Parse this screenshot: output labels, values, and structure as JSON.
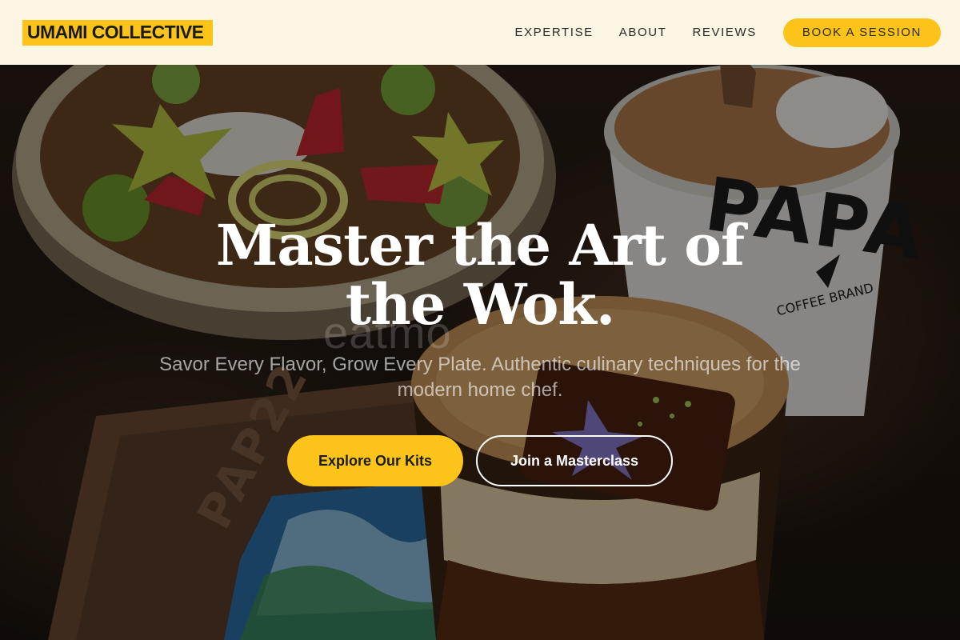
{
  "header": {
    "logo": "UMAMI COLLECTIVE",
    "nav": [
      {
        "label": "EXPERTISE"
      },
      {
        "label": "ABOUT"
      },
      {
        "label": "REVIEWS"
      }
    ],
    "cta": "BOOK A SESSION"
  },
  "hero": {
    "headline": "Master the Art of the Wok.",
    "subheadline": "Savor Every Flavor, Grow Every Plate. Authentic culinary techniques for the modern home chef.",
    "primary_button": "Explore Our Kits",
    "secondary_button": "Join a Masterclass",
    "watermark": "eatmo",
    "image_alt": "Fruit and granola bowl, coffee cup and iced drink on a wooden tray",
    "photo_text": {
      "cup_brand": "PAPA",
      "cup_sub": "COFFEE BRAND",
      "tray_brand": "PAP22"
    }
  },
  "colors": {
    "accent": "#fcc419",
    "header_bg": "#fbf5e3",
    "text_dark": "#2a2a2a",
    "hero_text": "#ffffff"
  }
}
